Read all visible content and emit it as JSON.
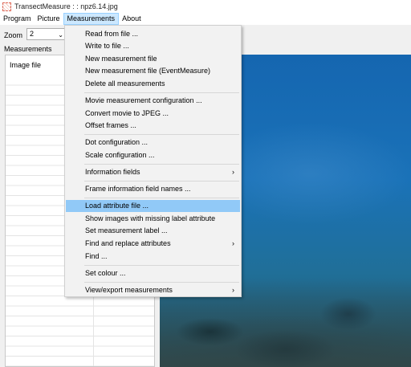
{
  "window": {
    "title": "TransectMeasure : : npz6.14.jpg"
  },
  "menubar": {
    "items": [
      "Program",
      "Picture",
      "Measurements",
      "About"
    ]
  },
  "toolbar": {
    "zoom_label": "Zoom",
    "zoom_value": "2"
  },
  "left": {
    "section_label": "Measurements",
    "column_header": "Image file"
  },
  "dropdown": {
    "items": [
      "Read from file ...",
      "Write to file ...",
      "New measurement file",
      "New measurement file (EventMeasure)",
      "Delete all measurements",
      "Movie measurement configuration ...",
      "Convert movie to JPEG ...",
      "Offset frames ...",
      "Dot configuration ...",
      "Scale configuration ...",
      "Information fields",
      "Frame information field names ...",
      "Load attribute file ...",
      "Show images with missing label attribute",
      "Set measurement label ...",
      "Find and replace attributes",
      "Find ...",
      "Set colour ...",
      "View/export measurements"
    ],
    "submenu_arrow": "›",
    "highlight_color": "#91c9f7"
  }
}
